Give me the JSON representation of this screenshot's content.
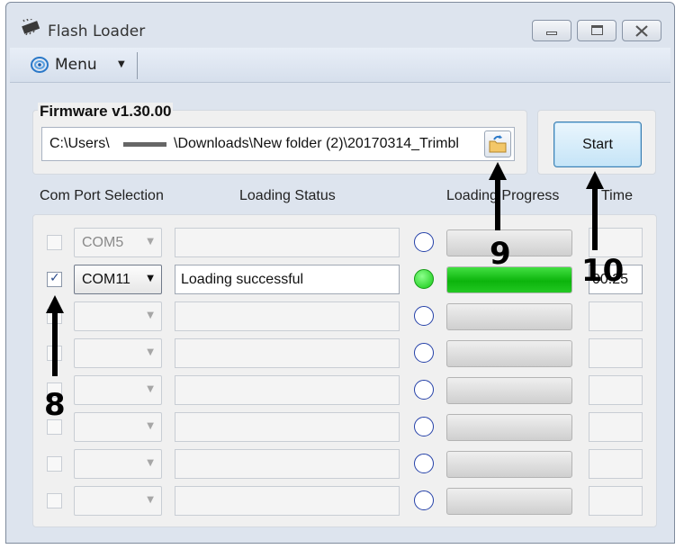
{
  "window": {
    "title": "Flash Loader",
    "minimize_glyph": "—",
    "maximize_glyph": "▭",
    "close_glyph": "✕"
  },
  "menu": {
    "label": "Menu"
  },
  "firmware": {
    "label": "Firmware v1.30.00",
    "path_prefix": "C:\\Users\\",
    "path_suffix": "\\Downloads\\New folder (2)\\20170314_Trimbl"
  },
  "start_label": "Start",
  "columns": {
    "com_port": "Com Port Selection",
    "status": "Loading Status",
    "progress": "Loading Progress",
    "time": "Time"
  },
  "rows": [
    {
      "checked": false,
      "port": "COM5",
      "status": "",
      "done": false,
      "progress": 0,
      "time": ""
    },
    {
      "checked": true,
      "port": "COM11",
      "status": "Loading successful",
      "done": true,
      "progress": 1,
      "time": "00:25"
    },
    {
      "checked": false,
      "port": "",
      "status": "",
      "done": false,
      "progress": 0,
      "time": ""
    },
    {
      "checked": false,
      "port": "",
      "status": "",
      "done": false,
      "progress": 0,
      "time": ""
    },
    {
      "checked": false,
      "port": "",
      "status": "",
      "done": false,
      "progress": 0,
      "time": ""
    },
    {
      "checked": false,
      "port": "",
      "status": "",
      "done": false,
      "progress": 0,
      "time": ""
    },
    {
      "checked": false,
      "port": "",
      "status": "",
      "done": false,
      "progress": 0,
      "time": ""
    },
    {
      "checked": false,
      "port": "",
      "status": "",
      "done": false,
      "progress": 0,
      "time": ""
    }
  ],
  "annotations": {
    "a8": "8",
    "a9": "9",
    "a10": "10"
  },
  "colors": {
    "led_on": "#12c812",
    "led_off_border": "#2440a8",
    "progress_fill": "#0cb40c"
  }
}
